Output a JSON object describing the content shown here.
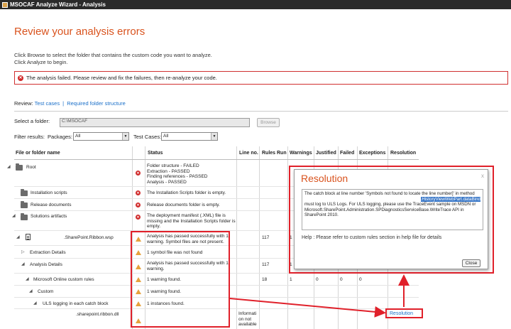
{
  "window": {
    "title": "MSOCAF Analyze Wizard - Analysis"
  },
  "page": {
    "heading": "Review your analysis errors",
    "instructions": [
      "Click Browse to select the folder that contains the custom code you want to analyze.",
      "Click Analyze to begin."
    ],
    "error_message": "The analysis failed. Please review and fix the failures, then re-analyze your code."
  },
  "review": {
    "label": "Review:",
    "links": [
      "Test cases",
      "Required folder structure"
    ]
  },
  "folder": {
    "label": "Select a folder:",
    "value": "C:\\MSOCAF",
    "browse_label": "Browse"
  },
  "filters": {
    "label": "Filter results:",
    "packages_label": "Packages:",
    "packages_value": "All",
    "testcases_label": "Test Cases:",
    "testcases_value": "All"
  },
  "table": {
    "headers": [
      "File or folder name",
      "Status",
      "Line no.",
      "Rules Run",
      "Warnings",
      "Justified",
      "Failed",
      "Exceptions",
      "Resolution"
    ],
    "rows": [
      {
        "name": "Root",
        "status": [
          "Folder structure - FAILED",
          "Extraction - PASSED",
          "Finding references - PASSED",
          "Analysis - PASSED"
        ],
        "icon": "error"
      },
      {
        "name": "Installation scripts",
        "status": [
          "The Installation Scripts folder is empty."
        ],
        "icon": "error"
      },
      {
        "name": "Release documents",
        "status": [
          "Release documents folder is empty."
        ],
        "icon": "error"
      },
      {
        "name": "Solutions artifacts",
        "status": [
          "The deployment manifest (.XML) file is",
          "missing and the Installation Scripts folder is",
          "empty."
        ],
        "icon": "error"
      },
      {
        "name": ".SharePoint.Ribbon.wsp",
        "status": [
          "Analysis has passed successfully with 1",
          "warning. Symbol files are not present."
        ],
        "icon": "warning",
        "rules_run": "117",
        "warnings": "1"
      },
      {
        "name": "Extraction Details",
        "status": [
          "1 symbol file was not found"
        ],
        "icon": "warning"
      },
      {
        "name": "Analysis Details",
        "status": [
          "Analysis has passed successfully with 1",
          "warning."
        ],
        "icon": "warning",
        "rules_run": "117",
        "warnings": "1"
      },
      {
        "name": "Microsoft Online custom rules",
        "status": [
          "1 warning found."
        ],
        "icon": "warning",
        "rules_run": "18",
        "warnings": "1",
        "justified": "0",
        "failed": "0",
        "exceptions": "0"
      },
      {
        "name": "Custom",
        "status": [
          "1 warning found."
        ],
        "icon": "warning"
      },
      {
        "name": "ULS logging in each catch block",
        "status": [
          "1 instances found."
        ],
        "icon": "warning"
      },
      {
        "name": ".sharepoint.ribbon.dll",
        "status": [],
        "icon": "warning",
        "line_no": [
          "Informati",
          "on not",
          "available"
        ],
        "resolution": "Resolution"
      }
    ]
  },
  "dialog": {
    "title": "Resolution",
    "close_glyph": "x",
    "text_line1": "The catch block at line number 'Symbols not found to locate the line number]' in method",
    "text_highlight": ".HistoryViewWebPart.dataBind",
    "text_rest": [
      "must log to ULS Logs. For ULS logging, please use the TraceEvent sample on MSDN or",
      "Microsoft.SharePoint.Administration.SPDiagnosticsServiceBase.WriteTrace API in",
      "SharePoint 2010."
    ],
    "help": "Help : Please refer to custom rules section in help file for details",
    "close_button": "Close"
  },
  "colors": {
    "accent": "#d9531e",
    "link": "#1a6fc9",
    "error": "#d02a2a",
    "warning": "#e6a23c",
    "highlight": "#e0202a"
  }
}
